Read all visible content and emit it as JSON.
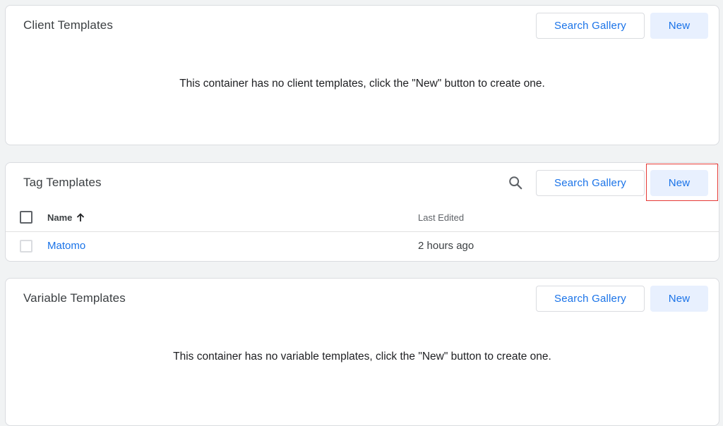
{
  "client_templates": {
    "title": "Client Templates",
    "search_gallery_label": "Search Gallery",
    "new_label": "New",
    "empty_message": "This container has no client templates, click the \"New\" button to create one."
  },
  "tag_templates": {
    "title": "Tag Templates",
    "search_icon": "search-icon",
    "search_gallery_label": "Search Gallery",
    "new_label": "New",
    "columns": {
      "name": "Name",
      "name_sort_icon": "arrow-up-icon",
      "last_edited": "Last Edited"
    },
    "rows": [
      {
        "name": "Matomo",
        "last_edited": "2 hours ago"
      }
    ]
  },
  "variable_templates": {
    "title": "Variable Templates",
    "search_gallery_label": "Search Gallery",
    "new_label": "New",
    "empty_message": "This container has no variable templates, click the \"New\" button to create one."
  },
  "colors": {
    "accent": "#1a73e8",
    "filled_button_bg": "#e8f0fe",
    "page_bg": "#f1f3f4",
    "highlight": "#e53935"
  }
}
